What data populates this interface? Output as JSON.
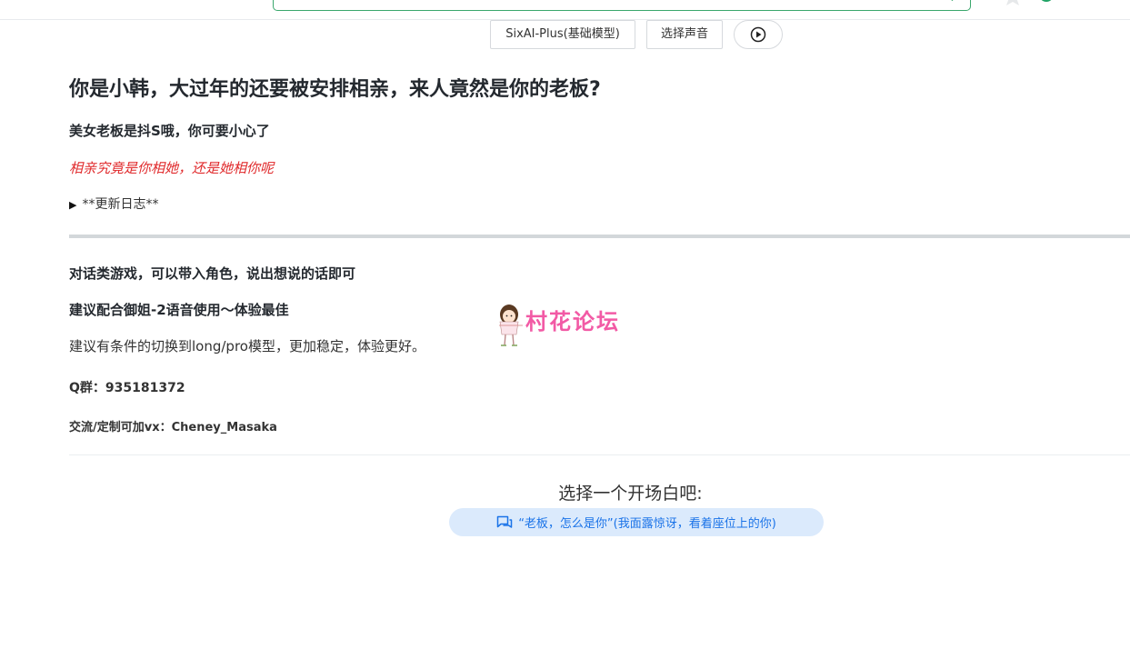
{
  "toolbar": {
    "model_label": "SixAI-Plus(基础模型)",
    "voice_label": "选择声音",
    "play_icon": "play-circle-icon"
  },
  "header_icons": {
    "search": "search-icon",
    "favorite": "star-icon",
    "bookmark": "bookmark-icon"
  },
  "card": {
    "title": "你是小韩，大过年的还要被安排相亲，来人竟然是你的老板?",
    "subtitle": "美女老板是抖S哦，你可要小心了",
    "tagline": "相亲究竟是你相她，还是她相你呢",
    "changelog_toggle": "▶",
    "changelog_label": "**更新日志**",
    "info_line1": "对话类游戏，可以带入角色，说出想说的话即可",
    "info_line2": "建议配合御姐-2语音使用～体验最佳",
    "info_line3": "建议有条件的切换到long/pro模型，更加稳定，体验更好。",
    "qgroup": "Q群：935181372",
    "contact": "交流/定制可加vx：Cheney_Masaka"
  },
  "openers": {
    "heading": "选择一个开场白吧:",
    "items": [
      {
        "label": "“老板，怎么是你”(我面露惊讶，看着座位上的你)",
        "icon": "chat-icon"
      }
    ]
  },
  "watermark": {
    "text": "村花论坛"
  },
  "colors": {
    "accent": "#3aa76d",
    "tagline_red": "#e0292b",
    "chip_bg": "#dbeafc",
    "chip_text": "#1a73e8",
    "watermark_pink": "#f25aa5"
  }
}
